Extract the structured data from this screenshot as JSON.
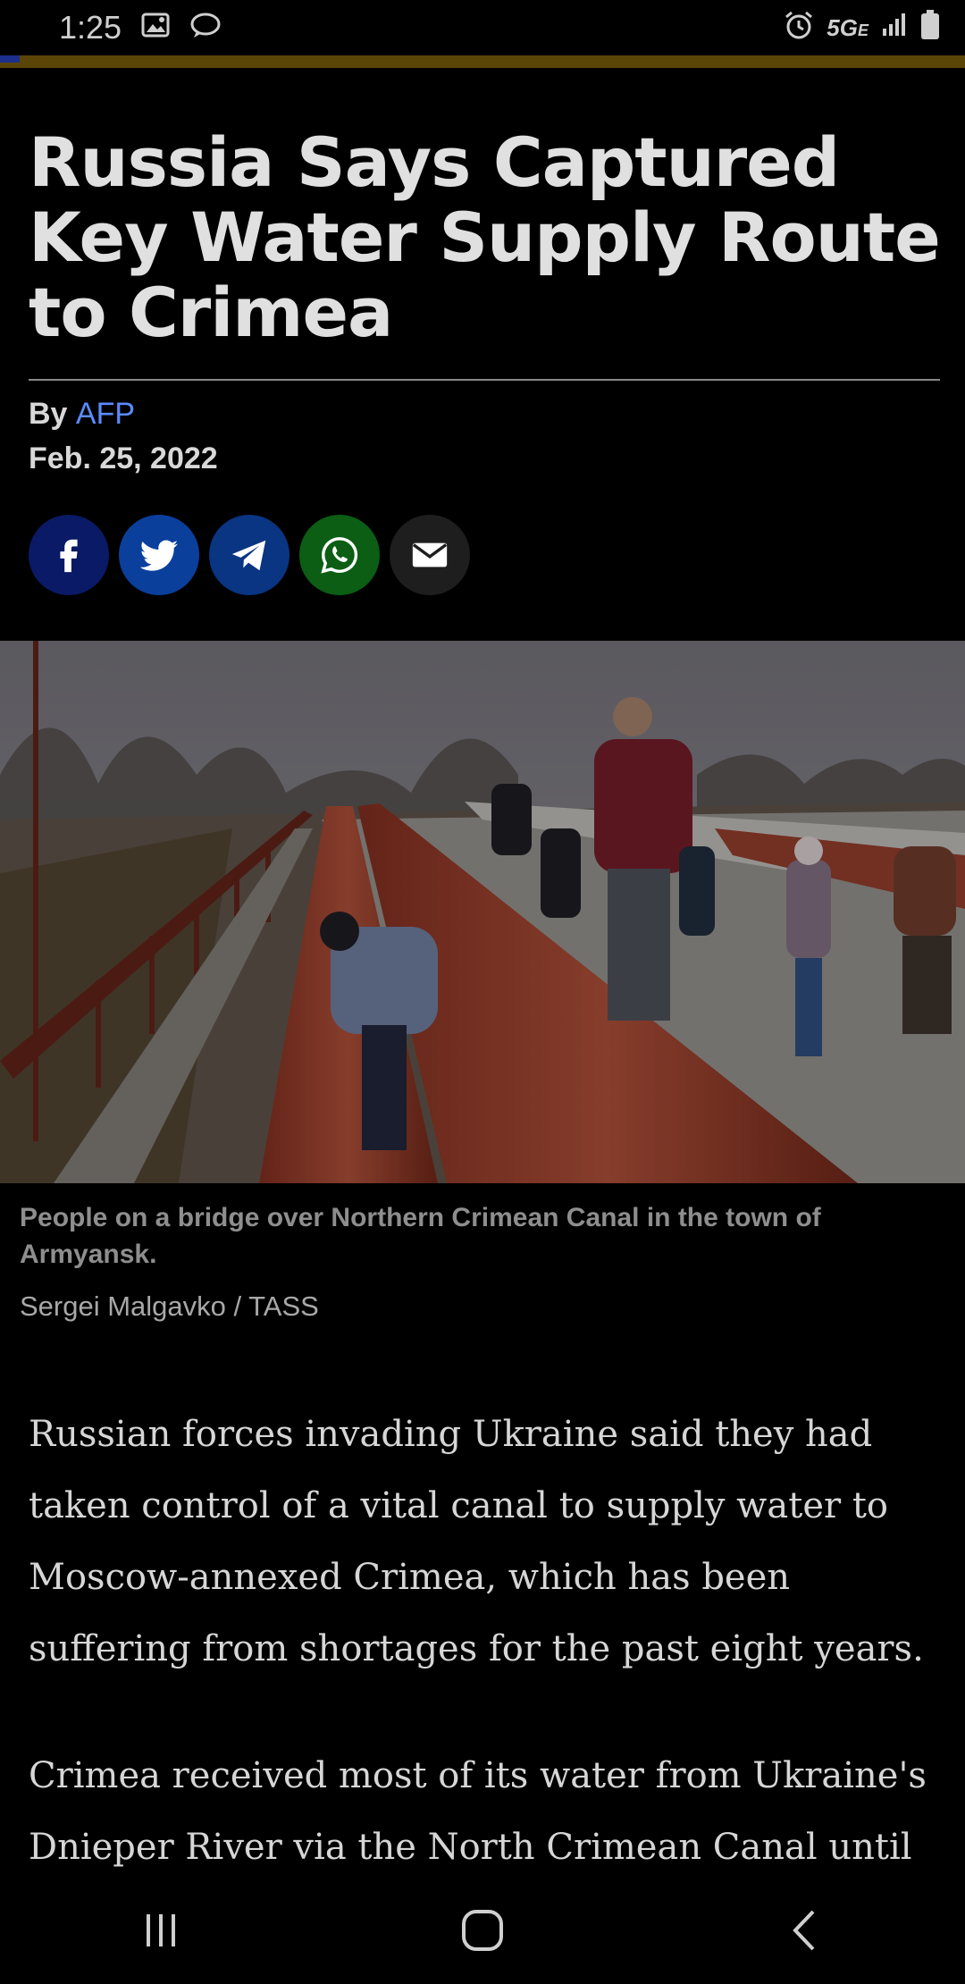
{
  "status_bar": {
    "time": "1:25",
    "network": "5G",
    "network_sub": "E",
    "icons": [
      "image-icon",
      "chat-icon",
      "alarm-icon",
      "signal-icon",
      "battery-icon"
    ]
  },
  "reading_progress": 0.02,
  "article": {
    "title": "Russia Says Captured Key Water Supply Route to Crimea",
    "byline_prefix": "By",
    "author": "AFP",
    "date": "Feb. 25, 2022"
  },
  "share_buttons": [
    {
      "name": "facebook",
      "icon": "facebook-icon",
      "color": "#0a1a66"
    },
    {
      "name": "twitter",
      "icon": "twitter-icon",
      "color": "#0a3f9c"
    },
    {
      "name": "telegram",
      "icon": "telegram-icon",
      "color": "#0a3583"
    },
    {
      "name": "whatsapp",
      "icon": "whatsapp-icon",
      "color": "#0b5e14"
    },
    {
      "name": "email",
      "icon": "email-icon",
      "color": "#1e1e1e"
    }
  ],
  "photo": {
    "caption": "People on a bridge over Northern Crimean Canal in the town of Armyansk.",
    "credit": "Sergei Malgavko / TASS"
  },
  "paragraphs": [
    "Russian forces invading Ukraine said they had taken control of a vital canal to supply water to Moscow-annexed Crimea, which has been suffering from shortages for the past eight years.",
    "Crimea received most of its water from Ukraine's Dnieper River via the North Crimean Canal until"
  ],
  "nav": {
    "icons": [
      "recent-apps-icon",
      "home-icon",
      "back-icon"
    ]
  }
}
